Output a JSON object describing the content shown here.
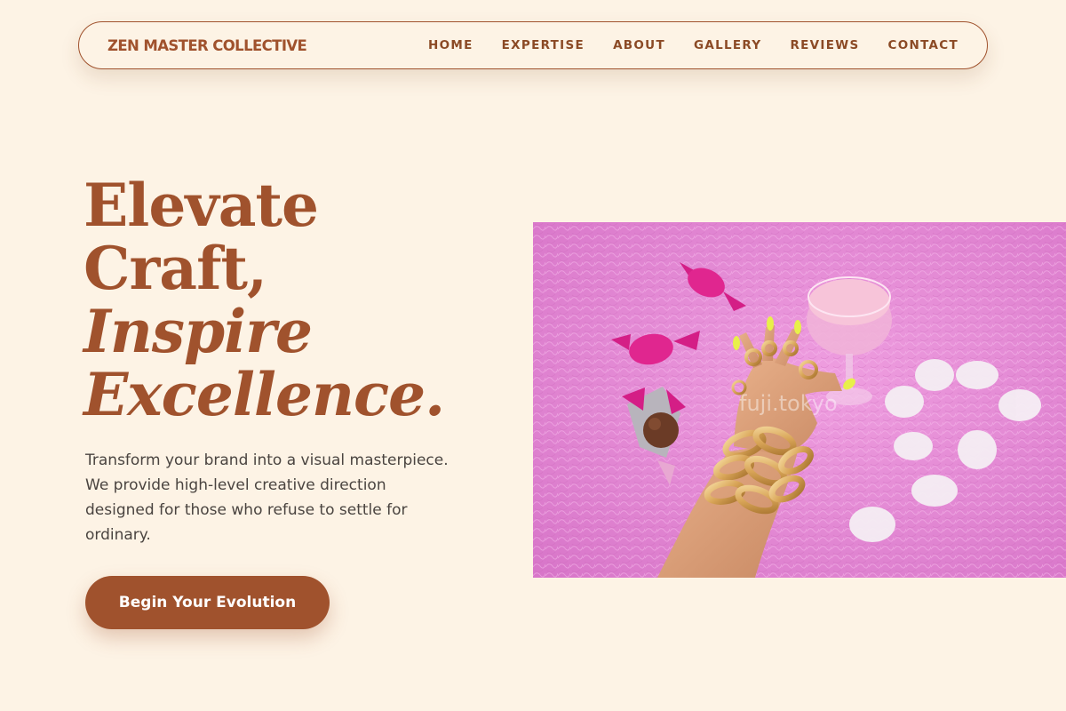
{
  "nav": {
    "brand": "ZEN MASTER COLLECTIVE",
    "links": [
      "HOME",
      "EXPERTISE",
      "ABOUT",
      "GALLERY",
      "REVIEWS",
      "CONTACT"
    ]
  },
  "hero": {
    "headline_line1": "Elevate",
    "headline_line2": "Craft,",
    "headline_line3": "Inspire",
    "headline_line4": "Excellence.",
    "subtext": "Transform your brand into a visual masterpiece. We provide high-level creative direction designed for those who refuse to settle for ordinary.",
    "cta_label": "Begin Your Evolution"
  },
  "image": {
    "watermark": "fuji.tokyo"
  },
  "colors": {
    "background": "#fdf3e5",
    "accent": "#a0522d",
    "text": "#4a4440",
    "image_bg": "#e58ad6"
  }
}
